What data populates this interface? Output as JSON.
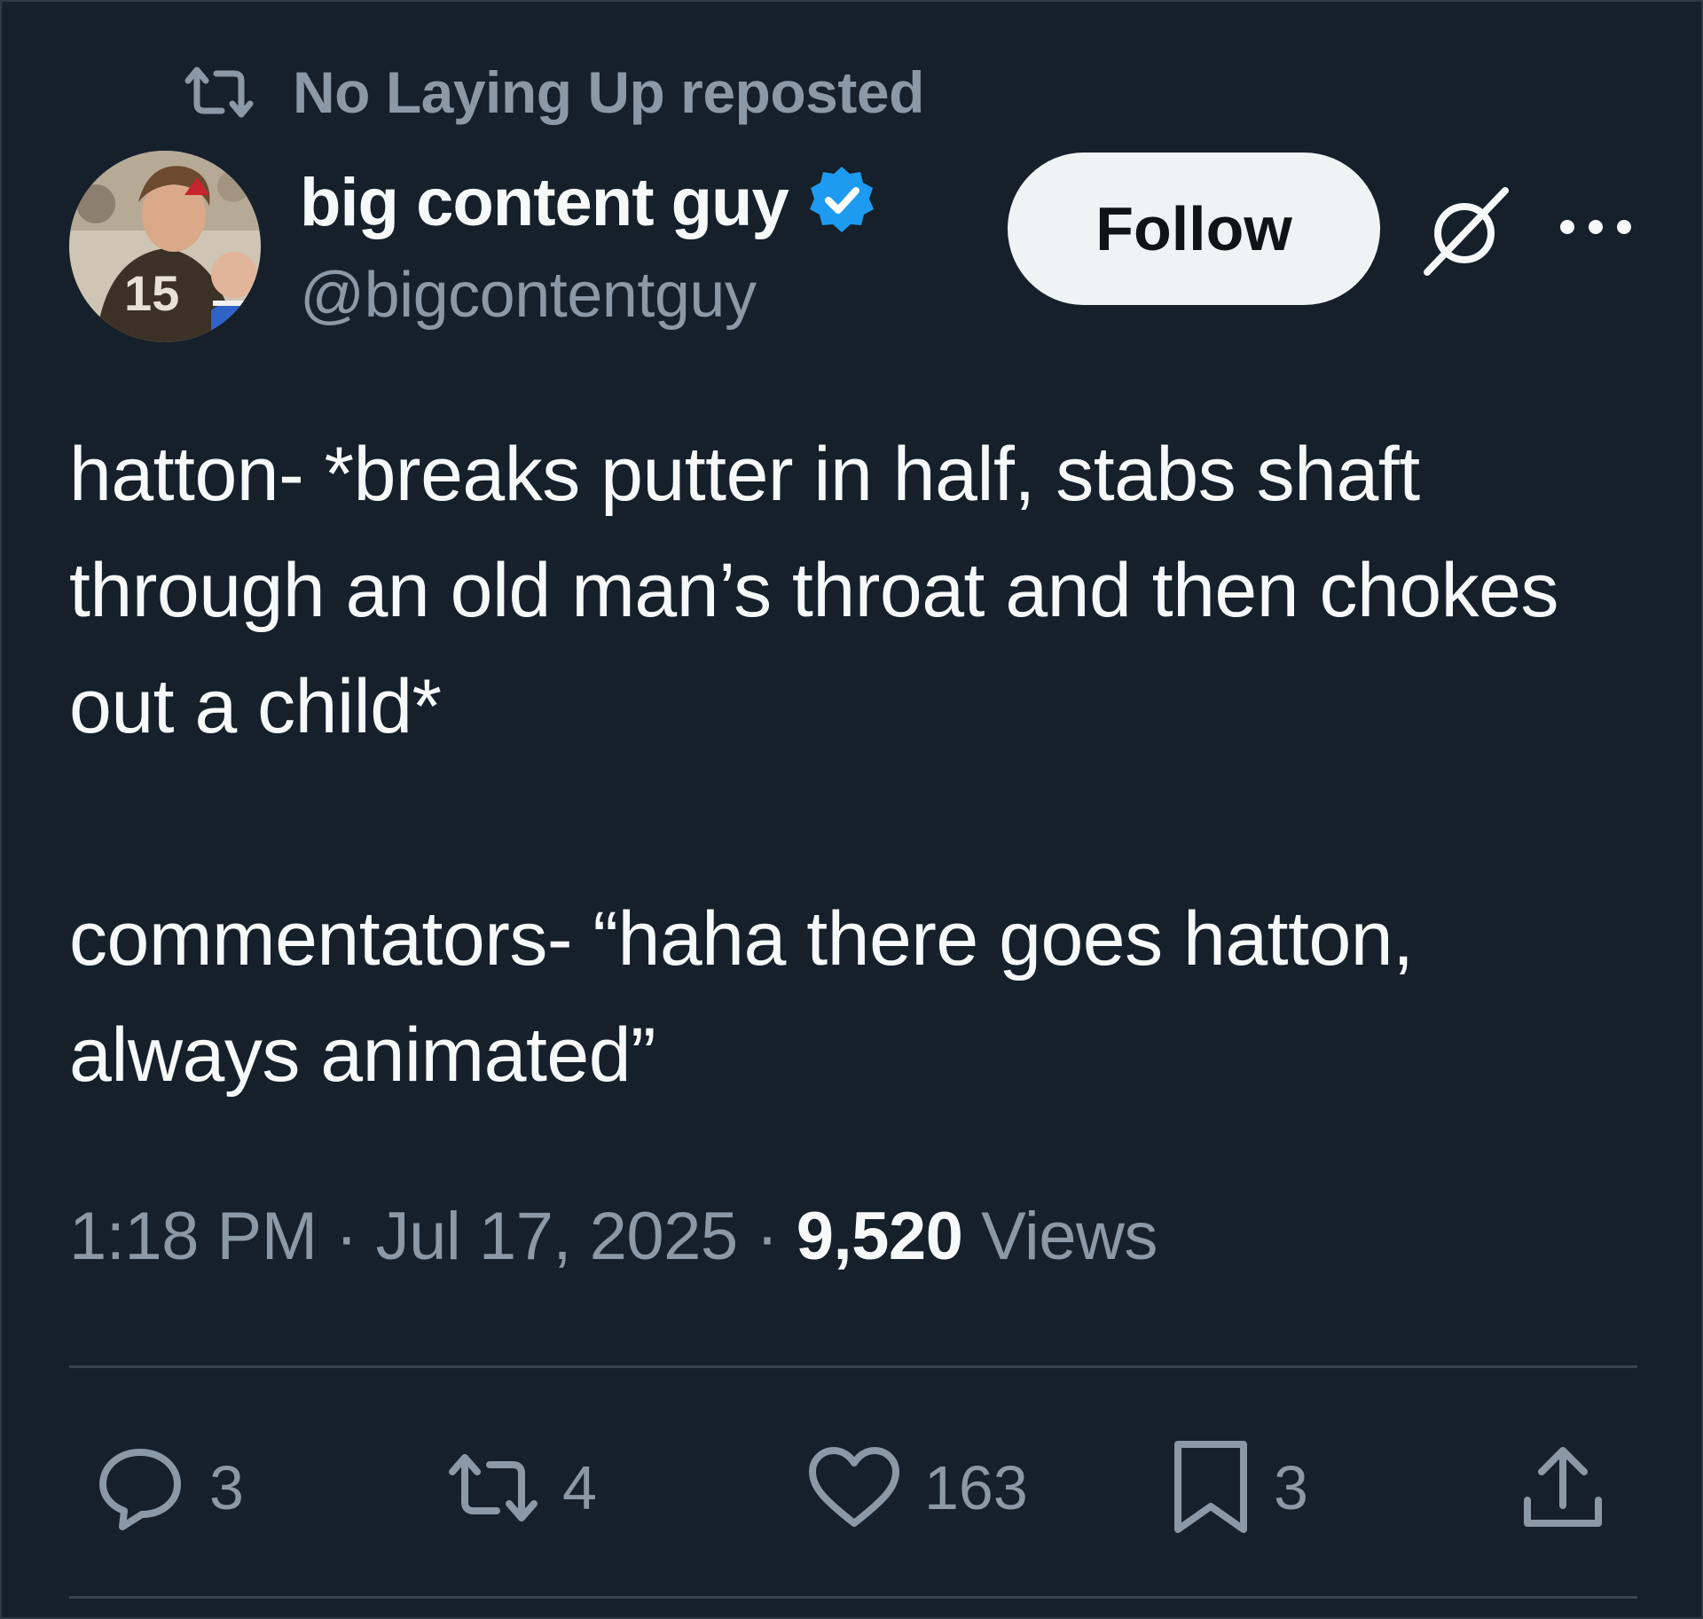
{
  "repost": {
    "icon": "repost-icon",
    "text": "No Laying Up reposted"
  },
  "author": {
    "display_name": "big content guy",
    "handle": "@bigcontentguy",
    "verified_icon": "verified-badge-icon",
    "avatar": "avatar"
  },
  "header_actions": {
    "follow_label": "Follow",
    "grok_icon": "grok-icon",
    "more_icon": "more-icon"
  },
  "tweet": {
    "text": "hatton- *breaks putter in half, stabs shaft through an old man’s throat and then chokes out a child*\n\ncommentators- “haha there goes hatton, always animated”"
  },
  "meta": {
    "time": "1:18 PM",
    "separator": " · ",
    "date": "Jul 17, 2025",
    "views_count": "9,520",
    "views_label": "Views"
  },
  "actions": {
    "reply": {
      "icon": "reply-icon",
      "count": "3"
    },
    "repost": {
      "icon": "repost-icon",
      "count": "4"
    },
    "like": {
      "icon": "heart-icon",
      "count": "163"
    },
    "bookmark": {
      "icon": "bookmark-icon",
      "count": "3"
    },
    "share": {
      "icon": "share-icon"
    }
  },
  "colors": {
    "background": "#15202b",
    "primary_text": "#f7f9f9",
    "secondary_text": "#8b98a5",
    "verified": "#1d9bf0",
    "divider": "#38444d",
    "follow_bg": "#eff3f4"
  }
}
